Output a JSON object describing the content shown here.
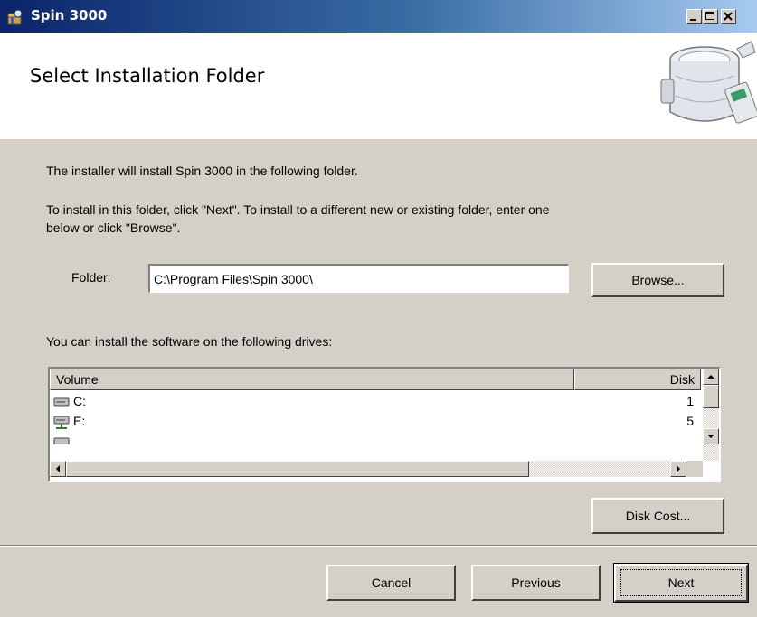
{
  "window": {
    "title": "Spin 3000",
    "icon": "installer-icon",
    "controls": [
      "minimize-icon",
      "maximize-icon",
      "close-icon"
    ]
  },
  "banner": {
    "title": "Select Installation Folder",
    "image": "product-image"
  },
  "body": {
    "intro": "The installer will install Spin 3000 in the following folder.",
    "instructions_line1": "To install in this folder, click \"Next\". To install to a different new or existing folder, enter one",
    "instructions_line2": "below or click \"Browse\"."
  },
  "folder": {
    "label": "Folder:",
    "value": "C:\\Program Files\\Spin 3000\\",
    "browse_label": "Browse..."
  },
  "drives": {
    "label": "You can install the software on the following drives:",
    "columns": [
      "Volume",
      "Disk"
    ],
    "rows": [
      {
        "volume": "C:",
        "size": "1",
        "icon": "hard-drive-icon"
      },
      {
        "volume": "E:",
        "size": "5",
        "icon": "network-drive-icon"
      }
    ]
  },
  "disk_cost_label": "Disk Cost...",
  "footer": {
    "cancel_label": "Cancel",
    "previous_label": "Previous",
    "next_label": "Next"
  },
  "colors": {
    "titlebar_start": "#0a246a",
    "titlebar_end": "#a6caf0",
    "dialog_face": "#d4d0c8",
    "banner_bg": "#ffffff"
  }
}
